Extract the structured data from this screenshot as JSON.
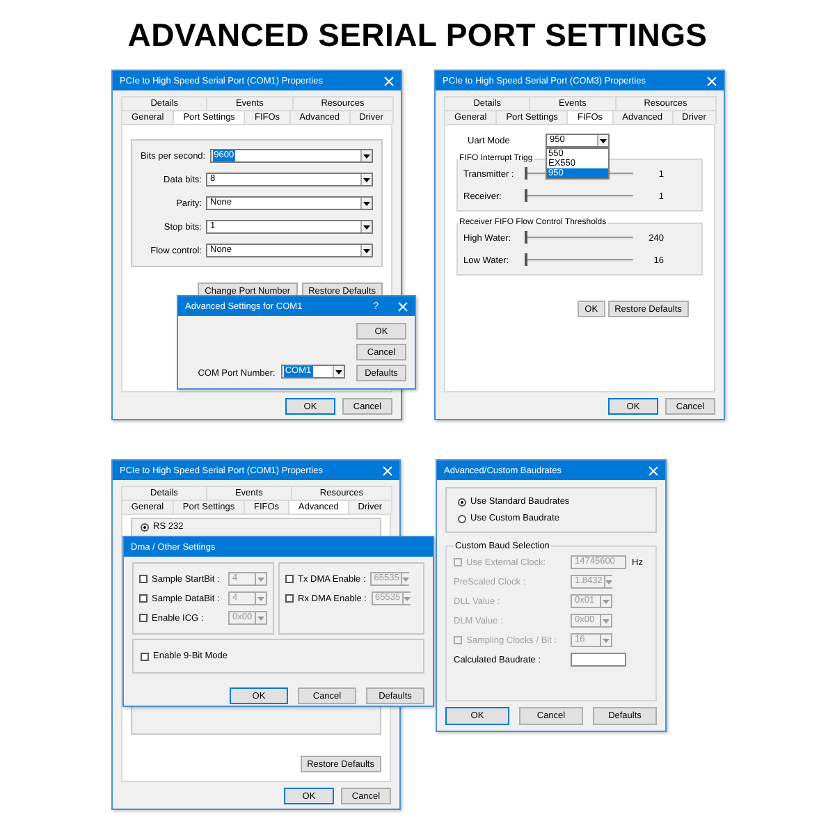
{
  "heading": "ADVANCED SERIAL PORT SETTINGS",
  "port_settings_window": {
    "title": "PCIe to High Speed Serial Port (COM1) Properties",
    "close_button": true,
    "tab_rows": [
      [
        {
          "label": "Details",
          "selected": false
        },
        {
          "label": "Events",
          "selected": false
        },
        {
          "label": "Resources",
          "selected": false
        }
      ],
      [
        {
          "label": "General",
          "selected": false
        },
        {
          "label": "Port Settings",
          "selected": true
        },
        {
          "label": "FIFOs",
          "selected": false
        },
        {
          "label": "Advanced",
          "selected": false
        },
        {
          "label": "Driver",
          "selected": false
        }
      ]
    ],
    "fields": [
      {
        "label": "Bits per second:",
        "value": "9600",
        "highlighted": true
      },
      {
        "label": "Data bits:",
        "value": "8",
        "highlighted": false
      },
      {
        "label": "Parity:",
        "value": "None",
        "highlighted": false
      },
      {
        "label": "Stop bits:",
        "value": "1",
        "highlighted": false
      },
      {
        "label": "Flow control:",
        "value": "None",
        "highlighted": false
      }
    ],
    "buttons": [
      {
        "label": "Change Port Number",
        "default": false
      },
      {
        "label": "Restore Defaults",
        "default": false
      }
    ],
    "footer_buttons": [
      {
        "label": "OK",
        "default": true
      },
      {
        "label": "Cancel",
        "default": false
      }
    ]
  },
  "com_port_dialog": {
    "title": "Advanced Settings for COM1",
    "help": "?",
    "close_button": true,
    "field": {
      "label": "COM Port Number:",
      "value": "COM1",
      "highlighted": true
    },
    "buttons": [
      {
        "label": "OK",
        "default": false
      },
      {
        "label": "Cancel",
        "default": false
      },
      {
        "label": "Defaults",
        "default": false
      }
    ]
  },
  "fifos_window": {
    "title": "PCIe to High Speed Serial Port (COM3)  Properties",
    "close_button": true,
    "tab_rows": [
      [
        {
          "label": "Details",
          "selected": false
        },
        {
          "label": "Events",
          "selected": false
        },
        {
          "label": "Resources",
          "selected": false
        }
      ],
      [
        {
          "label": "General",
          "selected": false
        },
        {
          "label": "Port Settings",
          "selected": false
        },
        {
          "label": "FIFOs",
          "selected": true
        },
        {
          "label": "Advanced",
          "selected": false
        },
        {
          "label": "Driver",
          "selected": false
        }
      ]
    ],
    "uart_mode": {
      "label": "Uart Mode",
      "value": "950",
      "options": [
        {
          "label": "550",
          "selected": false
        },
        {
          "label": "EX550",
          "selected": false
        },
        {
          "label": "950",
          "selected": true
        }
      ]
    },
    "groups": [
      {
        "title": "FIFO Interrupt Trigg",
        "sliders": [
          {
            "label": "Transmitter :",
            "level": 0,
            "reading": "1"
          },
          {
            "label": "Receiver:",
            "level": 0,
            "reading": "1"
          }
        ]
      },
      {
        "title": "Receiver FIFO Flow Control Thresholds",
        "sliders": [
          {
            "label": "High Water:",
            "level": 0,
            "reading": "240"
          },
          {
            "label": "Low Water:",
            "level": 0,
            "reading": "16"
          }
        ]
      }
    ],
    "buttons": [
      {
        "label": "OK",
        "default": false
      },
      {
        "label": "Restore Defaults",
        "default": false
      }
    ],
    "footer_buttons": [
      {
        "label": "OK",
        "default": true
      },
      {
        "label": "Cancel",
        "default": false
      }
    ]
  },
  "advanced_window": {
    "title": "PCIe to High Speed Serial Port (COM1) Properties",
    "close_button": true,
    "tab_rows": [
      [
        {
          "label": "Details",
          "selected": false
        },
        {
          "label": "Events",
          "selected": false
        },
        {
          "label": "Resources",
          "selected": false
        }
      ],
      [
        {
          "label": "General",
          "selected": false
        },
        {
          "label": "Port Settings",
          "selected": false
        },
        {
          "label": "FIFOs",
          "selected": false
        },
        {
          "label": "Advanced",
          "selected": true
        },
        {
          "label": "Driver",
          "selected": false
        }
      ]
    ],
    "radios": [
      {
        "label": "RS 232",
        "selected": true
      }
    ],
    "buttons": [
      {
        "label": "Restore Defaults",
        "default": false
      }
    ],
    "footer_buttons": [
      {
        "label": "OK",
        "default": true
      },
      {
        "label": "Cancel",
        "default": false
      }
    ]
  },
  "dma_dialog": {
    "title": "Dma / Other Settings",
    "close_button": false,
    "left_options": [
      {
        "label": "Sample StartBit :",
        "checked": false,
        "value": "4",
        "disabled": true
      },
      {
        "label": "Sample DataBit :",
        "checked": false,
        "value": "4",
        "disabled": true
      },
      {
        "label": "Enable ICG :",
        "checked": false,
        "value": "0x00",
        "disabled": true
      }
    ],
    "right_options": [
      {
        "label": "Tx DMA Enable :",
        "checked": false,
        "value": "65535",
        "disabled": true
      },
      {
        "label": "Rx DMA Enable :",
        "checked": false,
        "value": "65535",
        "disabled": true
      }
    ],
    "nine_bit": {
      "label": "Enable 9-Bit Mode",
      "checked": false
    },
    "buttons": [
      {
        "label": "OK",
        "default": true
      },
      {
        "label": "Cancel",
        "default": false
      },
      {
        "label": "Defaults",
        "default": false
      }
    ]
  },
  "baudrate_dialog": {
    "title": "Advanced/Custom Baudrates",
    "close_button": true,
    "radios": [
      {
        "label": "Use Standard Baudrates",
        "selected": true
      },
      {
        "label": "Use Custom Baudrate",
        "selected": false
      }
    ],
    "group": {
      "title": "Custom Baud Selection",
      "rows": [
        {
          "kind": "check_text",
          "label": "Use External Clock:",
          "checked": false,
          "value": "14745600",
          "unit": "Hz",
          "disabled": true
        },
        {
          "kind": "combo",
          "label": "PreScaled Clock :",
          "value": "1.8432",
          "disabled": true
        },
        {
          "kind": "combo",
          "label": "DLL Value :",
          "value": "0x01",
          "disabled": true
        },
        {
          "kind": "combo",
          "label": "DLM Value :",
          "value": "0x00",
          "disabled": true
        },
        {
          "kind": "check_combo",
          "label": "Sampling Clocks / Bit :",
          "checked": false,
          "value": "16",
          "disabled": true
        },
        {
          "kind": "text",
          "label": "Calculated Baudrate :",
          "disabled": false
        }
      ]
    },
    "buttons": [
      {
        "label": "OK",
        "default": true
      },
      {
        "label": "Cancel",
        "default": false
      },
      {
        "label": "Defaults",
        "default": false
      }
    ]
  }
}
